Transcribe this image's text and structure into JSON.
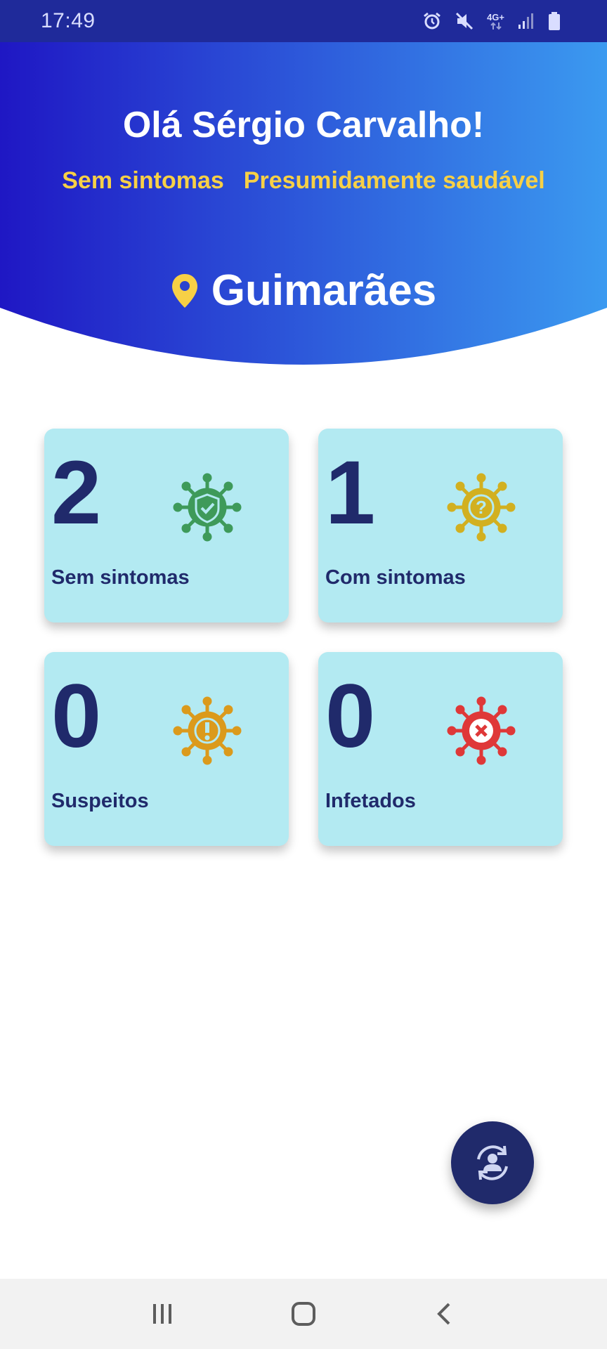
{
  "status_bar": {
    "time": "17:49",
    "network": "4G+"
  },
  "header": {
    "greeting": "Olá Sérgio Carvalho!",
    "symptom_status": "Sem sintomas",
    "health_status": "Presumidamente saudável",
    "location": "Guimarães"
  },
  "cards": [
    {
      "count": "2",
      "label": "Sem sintomas",
      "icon": "virus-shield-check-icon",
      "color": "#3e9a5a"
    },
    {
      "count": "1",
      "label": "Com sintomas",
      "icon": "virus-question-icon",
      "color": "#d2b020"
    },
    {
      "count": "0",
      "label": "Suspeitos",
      "icon": "virus-exclamation-icon",
      "color": "#db9a1c"
    },
    {
      "count": "0",
      "label": "Infetados",
      "icon": "virus-x-icon",
      "color": "#df3838"
    }
  ],
  "fab": {
    "icon": "sync-user-icon"
  },
  "colors": {
    "header_gradient_start": "#1f17c4",
    "header_gradient_end": "#3b9af0",
    "accent_yellow": "#f7d046",
    "card_bg": "#b3eaf2",
    "text_dark": "#202a6b"
  }
}
